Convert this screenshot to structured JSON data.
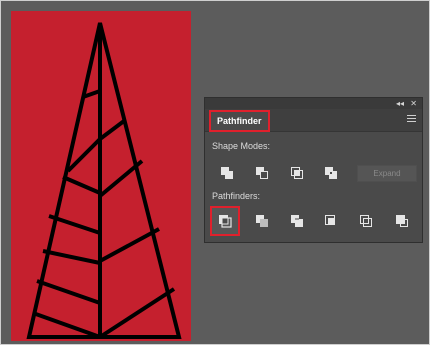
{
  "panel": {
    "collapse_glyph": "◂◂",
    "close_glyph": "✕",
    "tab_label": "Pathfinder",
    "menu_icon": "hamburger-menu-icon",
    "shape_modes": {
      "label": "Shape Modes:",
      "buttons": [
        "unite-icon",
        "minus-front-icon",
        "intersect-icon",
        "exclude-icon"
      ],
      "expand_label": "Expand"
    },
    "pathfinders": {
      "label": "Pathfinders:",
      "buttons": [
        "divide-icon",
        "trim-icon",
        "merge-icon",
        "crop-icon",
        "outline-icon",
        "minus-back-icon"
      ]
    }
  },
  "colors": {
    "artboard": "#c5202e",
    "highlight": "#e0202c",
    "panel": "#4a4a4a",
    "workspace": "#5c5c5c"
  }
}
